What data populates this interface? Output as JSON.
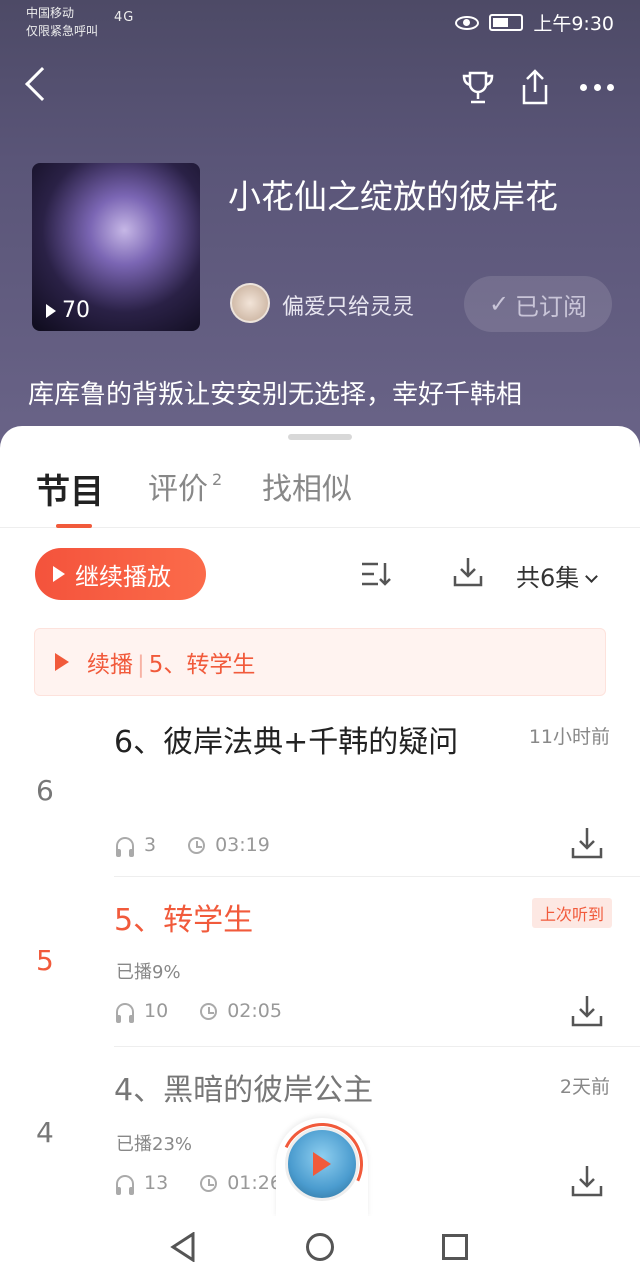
{
  "status_bar": {
    "carrier_line1": "中国移动",
    "carrier_line2": "仅限紧急呼叫",
    "network": "4G",
    "time": "上午9:30"
  },
  "album": {
    "title": "小花仙之绽放的彼岸花",
    "play_count": "70",
    "author": "偏爱只给灵灵",
    "subscribe_label": "已订阅",
    "description": "库库鲁的背叛让安安别无选择，幸好千韩相"
  },
  "tabs": [
    {
      "label": "节目",
      "active": true
    },
    {
      "label": "评价",
      "badge": "2"
    },
    {
      "label": "找相似"
    }
  ],
  "toolbar": {
    "continue_label": "继续播放",
    "episode_count": "共6集"
  },
  "resume": {
    "label": "续播",
    "episode": "5、转学生"
  },
  "episodes": [
    {
      "index": "6",
      "title": "6、彼岸法典+千韩的疑问",
      "time": "11小时前",
      "plays": "3",
      "duration": "03:19"
    },
    {
      "index": "5",
      "title": "5、转学生",
      "badge": "上次听到",
      "progress": "已播9%",
      "plays": "10",
      "duration": "02:05"
    },
    {
      "index": "4",
      "title": "4、黑暗的彼岸公主",
      "time": "2天前",
      "progress": "已播23%",
      "plays": "13",
      "duration": "01:26"
    }
  ],
  "colors": {
    "accent": "#f15a3b",
    "header_bg": "#5a5578"
  }
}
